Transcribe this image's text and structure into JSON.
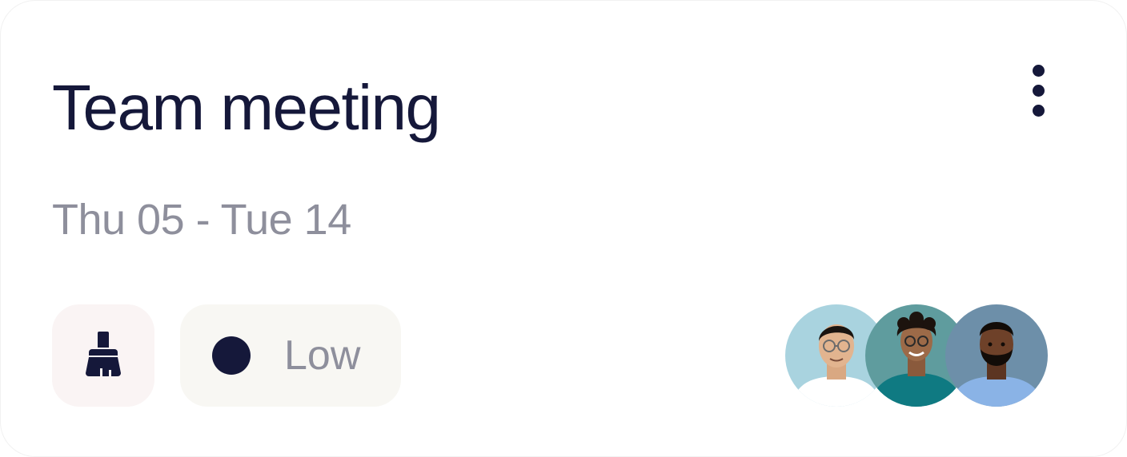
{
  "card": {
    "title": "Team meeting",
    "date_range": "Thu 05 - Tue 14",
    "menu_icon": "more-vertical-icon",
    "category": {
      "icon": "broom-icon"
    },
    "priority": {
      "label": "Low",
      "color": "#15183a"
    },
    "assignees": [
      {
        "name": "avatar-1",
        "background": "#a9d3df",
        "shirt": "#ffffff",
        "skin": "#e2b48f",
        "hair": "#1a1410",
        "glasses": true,
        "beard": false
      },
      {
        "name": "avatar-2",
        "background": "#5f9c9e",
        "shirt": "#0f7a82",
        "skin": "#9c6a48",
        "hair": "#1c130e",
        "glasses": true,
        "beard": false
      },
      {
        "name": "avatar-3",
        "background": "#6d8fa9",
        "shirt": "#8ab3e6",
        "skin": "#6e4129",
        "hair": "#120c08",
        "glasses": false,
        "beard": true
      }
    ]
  },
  "colors": {
    "text_primary": "#15183a",
    "text_secondary": "#8e8f9c",
    "category_chip_bg": "#faf4f4",
    "priority_chip_bg": "#f8f7f3"
  }
}
